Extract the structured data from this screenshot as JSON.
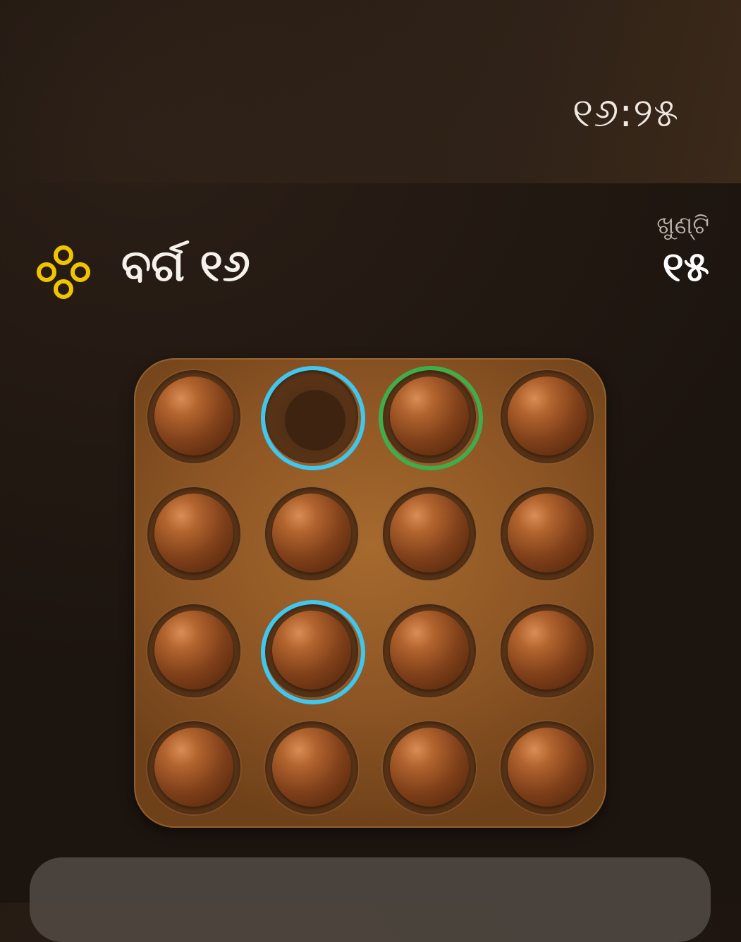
{
  "clock": "୧୬:୨୫",
  "level": {
    "title": "ବର୍ଗ ୧୬",
    "icon": "four-circles-icon",
    "icon_color": "#f2c400"
  },
  "score": {
    "label": "ଖୁଣ୍ଟି",
    "value": "୧୫"
  },
  "board": {
    "rows": 4,
    "cols": 4,
    "cells": [
      [
        "peg",
        "empty",
        "peg",
        "peg"
      ],
      [
        "peg",
        "peg",
        "peg",
        "peg"
      ],
      [
        "peg",
        "peg",
        "peg",
        "peg"
      ],
      [
        "peg",
        "peg",
        "peg",
        "peg"
      ]
    ],
    "highlights": [
      {
        "row": 0,
        "col": 1,
        "color": "blue"
      },
      {
        "row": 0,
        "col": 2,
        "color": "green"
      },
      {
        "row": 2,
        "col": 1,
        "color": "blue"
      }
    ],
    "highlight_colors": {
      "blue": "#3fc7ee",
      "green": "#3fae4a"
    }
  },
  "bottom_panel": {
    "text": ""
  }
}
